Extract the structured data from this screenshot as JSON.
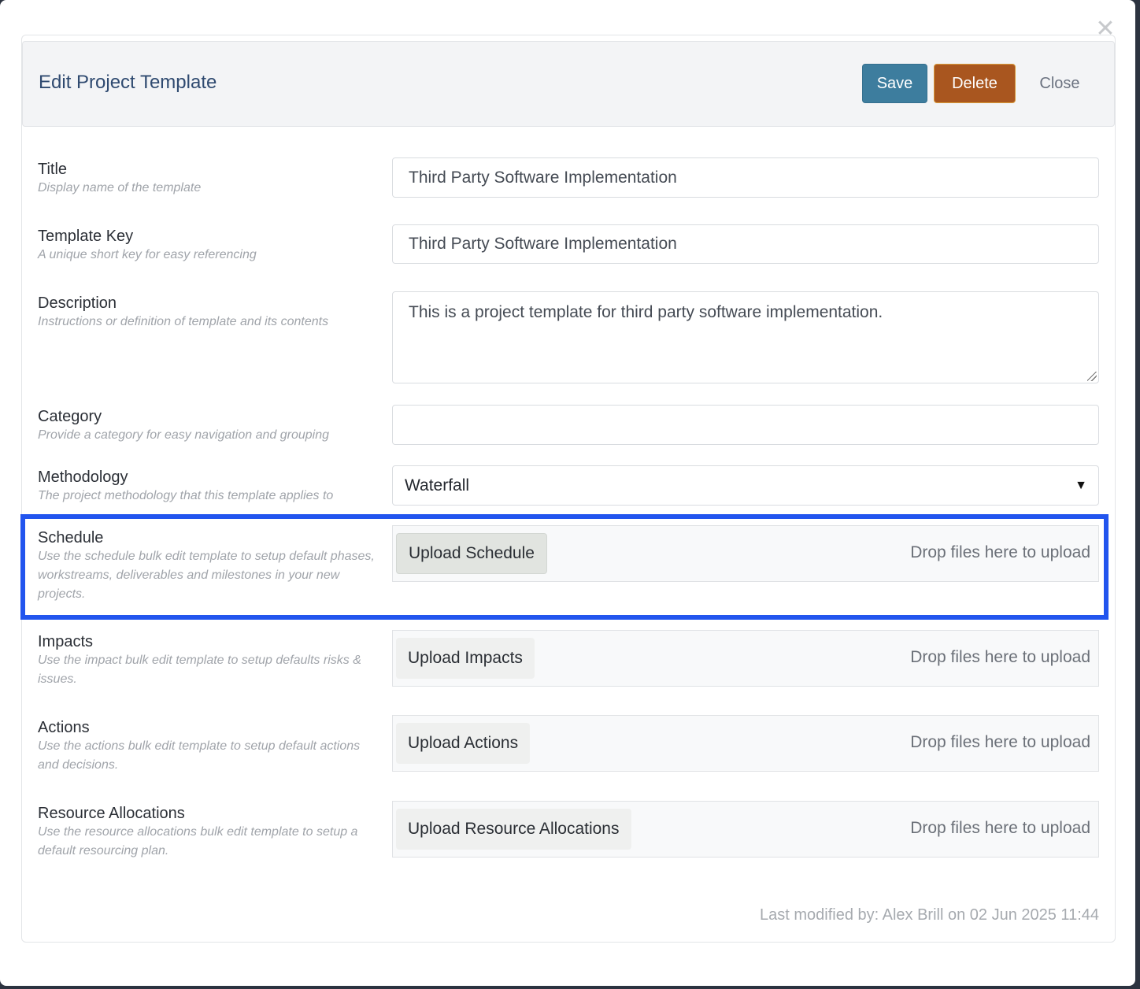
{
  "dialog": {
    "title": "Edit Project Template",
    "close_icon": "close-icon",
    "buttons": {
      "save": "Save",
      "delete": "Delete",
      "close": "Close"
    },
    "colors": {
      "save": "#3d7d9e",
      "delete": "#a9561f",
      "title": "#2f4a70",
      "highlight": "#2255ee"
    }
  },
  "form": {
    "title": {
      "label": "Title",
      "hint": "Display name of the template",
      "value": "Third Party Software Implementation"
    },
    "template_key": {
      "label": "Template Key",
      "hint": "A unique short key for easy referencing",
      "value": "Third Party Software Implementation"
    },
    "description": {
      "label": "Description",
      "hint": "Instructions or definition of template and its contents",
      "value": "This is a project template for third party software implementation."
    },
    "category": {
      "label": "Category",
      "hint": "Provide a category for easy navigation and grouping",
      "value": ""
    },
    "methodology": {
      "label": "Methodology",
      "hint": "The project methodology that this template applies to",
      "value": "Waterfall"
    },
    "schedule": {
      "label": "Schedule",
      "hint": "Use the schedule bulk edit template to setup default phases, workstreams, deliverables and milestones in your new projects.",
      "button": "Upload Schedule",
      "drop": "Drop files here to upload"
    },
    "impacts": {
      "label": "Impacts",
      "hint": "Use the impact bulk edit template to setup defaults risks & issues.",
      "button": "Upload Impacts",
      "drop": "Drop files here to upload"
    },
    "actions": {
      "label": "Actions",
      "hint": "Use the actions bulk edit template to setup default actions and decisions.",
      "button": "Upload Actions",
      "drop": "Drop files here to upload"
    },
    "resource_allocations": {
      "label": "Resource Allocations",
      "hint": "Use the resource allocations bulk edit template to setup a default resourcing plan.",
      "button": "Upload Resource Allocations",
      "drop": "Drop files here to upload"
    }
  },
  "footer": {
    "last_modified": "Last modified by: Alex Brill on 02 Jun 2025 11:44"
  }
}
